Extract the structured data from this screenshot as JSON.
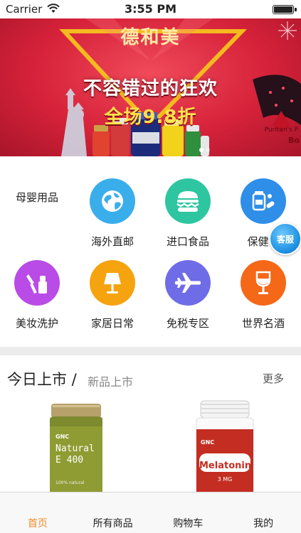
{
  "status_bar": {
    "carrier": "Carrier",
    "time": "3:55 PM"
  },
  "banner": {
    "brand": "德和美",
    "headline": "不容错过的狂欢",
    "promo": "全场9.8折",
    "side_text": "Puritan's P",
    "side_text2": "Bo",
    "page_count": 2,
    "active_page": 1
  },
  "categories": {
    "section_label": "母婴用品",
    "items": [
      {
        "label": "海外直邮",
        "icon": "globe-icon",
        "color": "#3aaeea"
      },
      {
        "label": "进口食品",
        "icon": "burger-icon",
        "color": "#2dc6a0"
      },
      {
        "label": "保健食",
        "icon": "medicine-icon",
        "color": "#2e8ee8"
      },
      {
        "label": "美妆洗护",
        "icon": "cosmetics-icon",
        "color": "#b94be6"
      },
      {
        "label": "家居日常",
        "icon": "lamp-icon",
        "color": "#f5a30f"
      },
      {
        "label": "免税专区",
        "icon": "airplane-icon",
        "color": "#6f6ce8"
      },
      {
        "label": "世界名酒",
        "icon": "wine-glass-icon",
        "color": "#f56818"
      }
    ],
    "service_badge": "客服"
  },
  "new_section": {
    "title": "今日上市 /",
    "subtitle": "新品上市",
    "more": "更多"
  },
  "products": [
    {
      "brand": "GNC",
      "name_line1": "Natural",
      "name_line2": "E 400",
      "note": "100% natural"
    },
    {
      "brand": "GNC",
      "name_line1": "Melatonin",
      "name_line2": "3 MG"
    }
  ],
  "tab_bar": {
    "tabs": [
      {
        "label": "首页",
        "active": true
      },
      {
        "label": "所有商品",
        "active": false
      },
      {
        "label": "购物车",
        "active": false
      },
      {
        "label": "我的",
        "active": false
      }
    ]
  },
  "colors": {
    "accent": "#f08a2a",
    "banner_red": "#d6223a"
  }
}
